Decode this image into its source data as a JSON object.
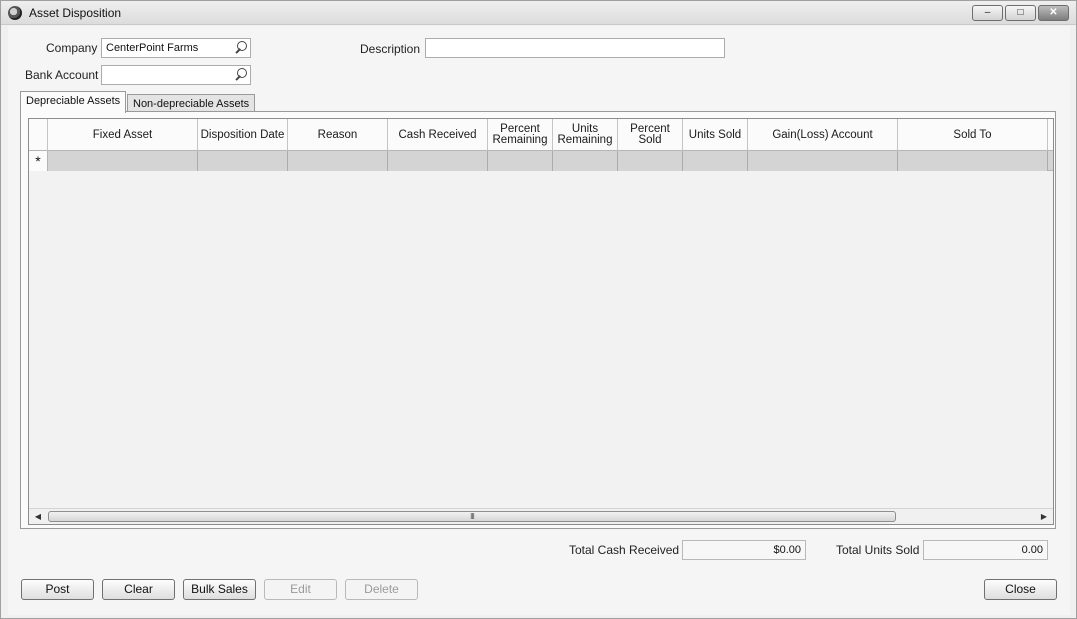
{
  "window": {
    "title": "Asset Disposition",
    "controls": {
      "minimize": "–",
      "maximize": "□",
      "close": "✕"
    }
  },
  "form": {
    "company_label": "Company",
    "company_value": "CenterPoint Farms",
    "bank_account_label": "Bank Account",
    "bank_account_value": "",
    "description_label": "Description",
    "description_value": ""
  },
  "tabs": [
    {
      "label": "Depreciable Assets",
      "active": true
    },
    {
      "label": "Non-depreciable Assets",
      "active": false
    }
  ],
  "grid": {
    "columns": [
      "Fixed Asset",
      "Disposition Date",
      "Reason",
      "Cash Received",
      "Percent\nRemaining",
      "Units\nRemaining",
      "Percent\nSold",
      "Units Sold",
      "Gain(Loss) Account",
      "Sold To"
    ],
    "new_row_marker": "*",
    "scroll_thumb_grip": "III"
  },
  "totals": {
    "cash_received_label": "Total Cash Received",
    "cash_received_value": "$0.00",
    "units_sold_label": "Total Units Sold",
    "units_sold_value": "0.00"
  },
  "buttons": {
    "post": "Post",
    "clear": "Clear",
    "bulk_sales": "Bulk Sales",
    "edit": "Edit",
    "delete": "Delete",
    "close": "Close"
  }
}
